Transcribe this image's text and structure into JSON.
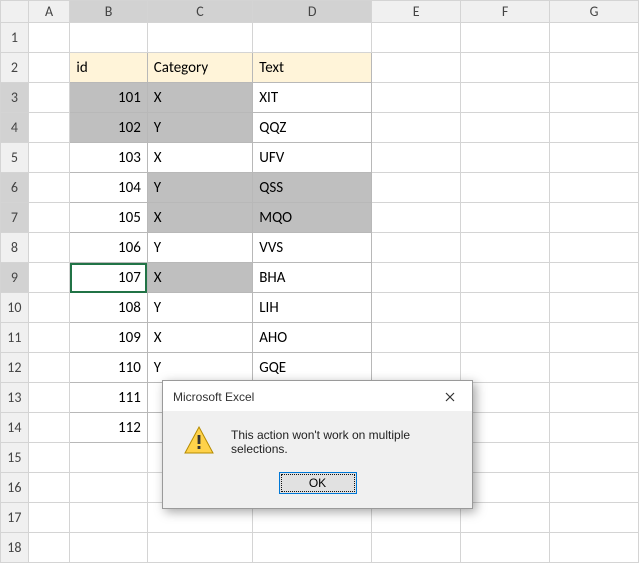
{
  "columns": [
    "A",
    "B",
    "C",
    "D",
    "E",
    "F",
    "G"
  ],
  "rows_count": 18,
  "table": {
    "headers": {
      "id": "id",
      "category": "Category",
      "text": "Text"
    },
    "data": [
      {
        "id": "101",
        "category": "X",
        "text": "XIT"
      },
      {
        "id": "102",
        "category": "Y",
        "text": "QQZ"
      },
      {
        "id": "103",
        "category": "X",
        "text": "UFV"
      },
      {
        "id": "104",
        "category": "Y",
        "text": "QSS"
      },
      {
        "id": "105",
        "category": "X",
        "text": "MQO"
      },
      {
        "id": "106",
        "category": "Y",
        "text": "VVS"
      },
      {
        "id": "107",
        "category": "X",
        "text": "BHA"
      },
      {
        "id": "108",
        "category": "Y",
        "text": "LIH"
      },
      {
        "id": "109",
        "category": "X",
        "text": "AHO"
      },
      {
        "id": "110",
        "category": "Y",
        "text": "GQE"
      },
      {
        "id": "111",
        "category": "",
        "text": ""
      },
      {
        "id": "112",
        "category": "",
        "text": ""
      }
    ]
  },
  "dialog": {
    "title": "Microsoft Excel",
    "message": "This action won't work on multiple selections.",
    "ok": "OK"
  }
}
